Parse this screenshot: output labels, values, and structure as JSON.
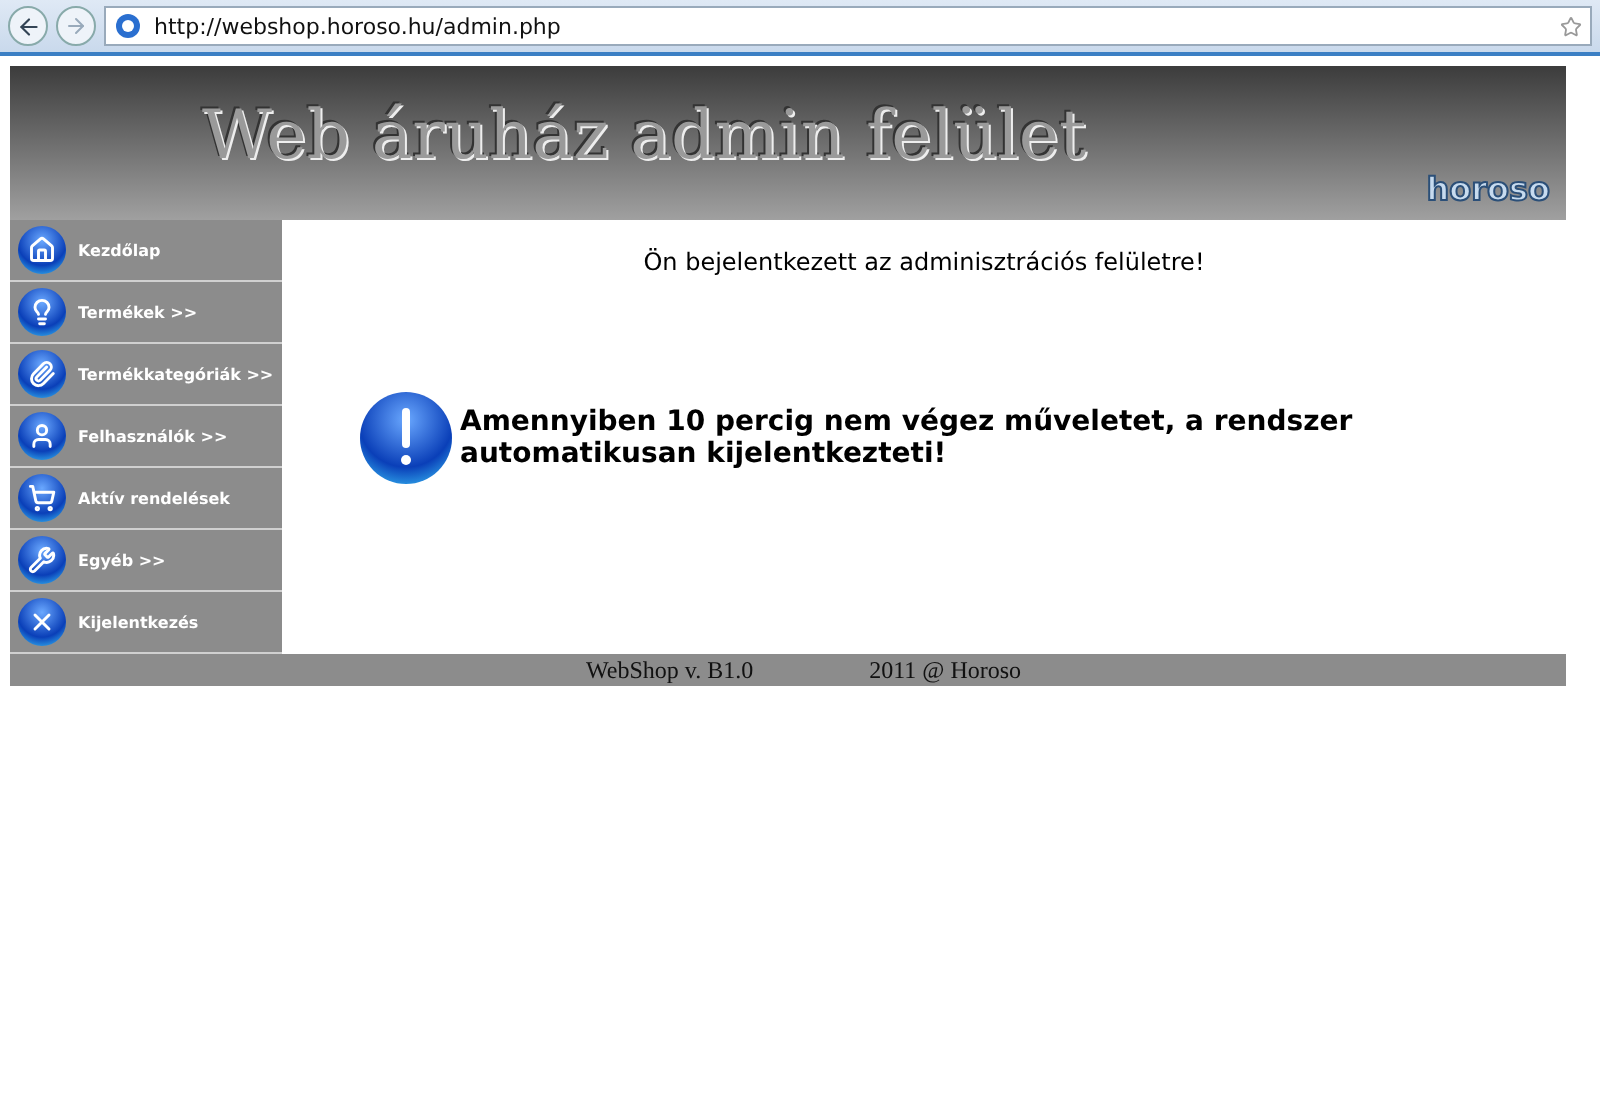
{
  "browser": {
    "address": "http://webshop.horoso.hu/admin.php"
  },
  "header": {
    "title": "Web áruház admin felület",
    "logo": "horoso"
  },
  "menu": [
    {
      "label": "Kezdőlap"
    },
    {
      "label": "Termékek >>"
    },
    {
      "label": "Termékkategóriák >>"
    },
    {
      "label": "Felhasználók >>"
    },
    {
      "label": "Aktív rendelések"
    },
    {
      "label": "Egyéb >>"
    },
    {
      "label": "Kijelentkezés"
    }
  ],
  "content": {
    "welcome": "Ön bejelentkezett az adminisztrációs felületre!",
    "warning": "Amennyiben 10 percig nem végez műveletet, a rendszer automatikusan kijelentkezteti!"
  },
  "footer": {
    "version": "WebShop v. B1.0",
    "copyright": "2011 @ Horoso"
  }
}
